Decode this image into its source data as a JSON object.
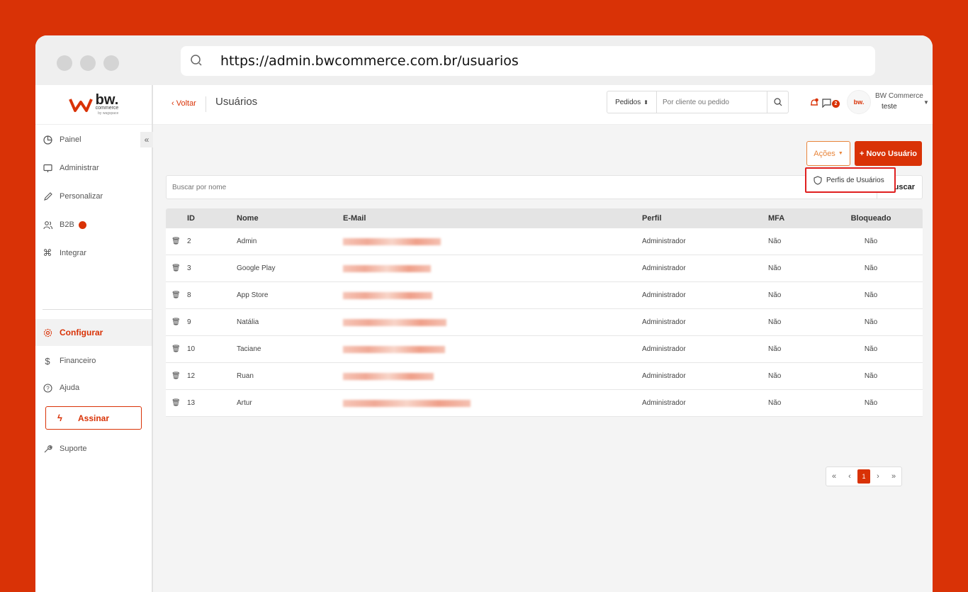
{
  "browser": {
    "url": "https://admin.bwcommerce.com.br/usuarios"
  },
  "logo": {
    "text": "bw.",
    "sub": "commerce",
    "sub2": "by wagspace"
  },
  "sidebar": {
    "items": [
      {
        "label": "Painel",
        "icon": "pie-chart-icon"
      },
      {
        "label": "Administrar",
        "icon": "monitor-icon"
      },
      {
        "label": "Personalizar",
        "icon": "pencil-icon"
      },
      {
        "label": "B2B",
        "icon": "users-icon"
      },
      {
        "label": "Integrar",
        "icon": "command-icon"
      },
      {
        "label": "Configurar",
        "icon": "gear-icon"
      },
      {
        "label": "Financeiro",
        "icon": "dollar-icon"
      },
      {
        "label": "Ajuda",
        "icon": "help-icon"
      },
      {
        "label": "Suporte",
        "icon": "wrench-icon"
      }
    ],
    "assinar": "Assinar",
    "collapse": "«"
  },
  "topbar": {
    "back": "‹ Voltar",
    "title": "Usuários",
    "select": "Pedidos",
    "search_placeholder": "Por cliente ou pedido",
    "msg_count": "2",
    "user_name": "BW Commerce",
    "user_sub": "teste"
  },
  "actions": {
    "acoes": "Ações",
    "novo": "+ Novo Usuário",
    "dropdown_item": "Perfis de Usuários"
  },
  "search": {
    "placeholder": "Buscar por nome",
    "button": "Buscar"
  },
  "table": {
    "headers": {
      "id": "ID",
      "nome": "Nome",
      "email": "E-Mail",
      "perfil": "Perfil",
      "mfa": "MFA",
      "bloqueado": "Bloqueado"
    },
    "rows": [
      {
        "id": "2",
        "nome": "Admin",
        "perfil": "Administrador",
        "mfa": "Não",
        "bloqueado": "Não"
      },
      {
        "id": "3",
        "nome": "Google Play",
        "perfil": "Administrador",
        "mfa": "Não",
        "bloqueado": "Não"
      },
      {
        "id": "8",
        "nome": "App Store",
        "perfil": "Administrador",
        "mfa": "Não",
        "bloqueado": "Não"
      },
      {
        "id": "9",
        "nome": "Natália",
        "perfil": "Administrador",
        "mfa": "Não",
        "bloqueado": "Não"
      },
      {
        "id": "10",
        "nome": "Taciane",
        "perfil": "Administrador",
        "mfa": "Não",
        "bloqueado": "Não"
      },
      {
        "id": "12",
        "nome": "Ruan",
        "perfil": "Administrador",
        "mfa": "Não",
        "bloqueado": "Não"
      },
      {
        "id": "13",
        "nome": "Artur",
        "perfil": "Administrador",
        "mfa": "Não",
        "bloqueado": "Não"
      }
    ]
  },
  "pagination": {
    "first": "«",
    "prev": "‹",
    "current": "1",
    "next": "›",
    "last": "»"
  },
  "colors": {
    "brand": "#D93206",
    "accent": "#E8853B",
    "highlight": "#E02020"
  }
}
